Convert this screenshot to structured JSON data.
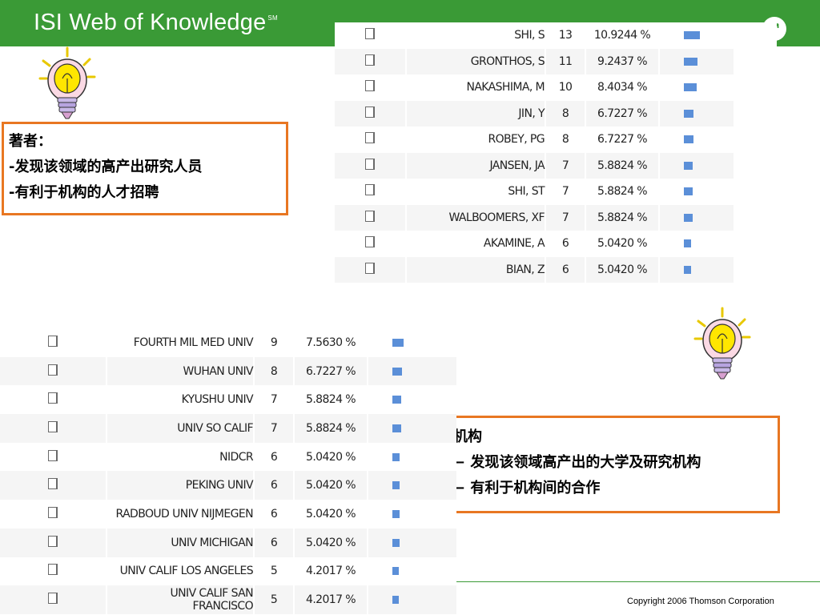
{
  "header": {
    "brand": "ISI Web of Knowledge",
    "brand_mark": "SM",
    "colors": {
      "bar": "#3a9a36",
      "callout_border": "#e87722",
      "bar_fill": "#5b8fd8"
    }
  },
  "authors_callout": {
    "line1": "著者：",
    "line2": "-发现该领域的高产出研究人员",
    "line3": "-有利于机构的人才招聘"
  },
  "orgs_callout": {
    "line1": "机构",
    "line2": "− 发现该领域高产出的大学及研究机构",
    "line3": "− 有利于机构间的合作"
  },
  "author_rows": [
    {
      "name": "SHI, S",
      "count": "13",
      "percent": "10.9244 %",
      "share": 0.109
    },
    {
      "name": "GRONTHOS, S",
      "count": "11",
      "percent": "9.2437 %",
      "share": 0.092
    },
    {
      "name": "NAKASHIMA, M",
      "count": "10",
      "percent": "8.4034 %",
      "share": 0.084
    },
    {
      "name": "JIN, Y",
      "count": "8",
      "percent": "6.7227 %",
      "share": 0.067
    },
    {
      "name": "ROBEY, PG",
      "count": "8",
      "percent": "6.7227 %",
      "share": 0.067
    },
    {
      "name": "JANSEN, JA",
      "count": "7",
      "percent": "5.8824 %",
      "share": 0.059
    },
    {
      "name": "SHI, ST",
      "count": "7",
      "percent": "5.8824 %",
      "share": 0.059
    },
    {
      "name": "WALBOOMERS, XF",
      "count": "7",
      "percent": "5.8824 %",
      "share": 0.059
    },
    {
      "name": "AKAMINE, A",
      "count": "6",
      "percent": "5.0420 %",
      "share": 0.05
    },
    {
      "name": "BIAN, Z",
      "count": "6",
      "percent": "5.0420 %",
      "share": 0.05
    }
  ],
  "org_rows": [
    {
      "name": "FOURTH MIL MED UNIV",
      "count": "9",
      "percent": "7.5630 %",
      "share": 0.076
    },
    {
      "name": "WUHAN UNIV",
      "count": "8",
      "percent": "6.7227 %",
      "share": 0.067
    },
    {
      "name": "KYUSHU UNIV",
      "count": "7",
      "percent": "5.8824 %",
      "share": 0.059
    },
    {
      "name": "UNIV SO CALIF",
      "count": "7",
      "percent": "5.8824 %",
      "share": 0.059
    },
    {
      "name": "NIDCR",
      "count": "6",
      "percent": "5.0420 %",
      "share": 0.05
    },
    {
      "name": "PEKING UNIV",
      "count": "6",
      "percent": "5.0420 %",
      "share": 0.05
    },
    {
      "name": "RADBOUD UNIV NIJMEGEN",
      "count": "6",
      "percent": "5.0420 %",
      "share": 0.05
    },
    {
      "name": "UNIV MICHIGAN",
      "count": "6",
      "percent": "5.0420 %",
      "share": 0.05
    },
    {
      "name": "UNIV CALIF LOS ANGELES",
      "count": "5",
      "percent": "4.2017 %",
      "share": 0.042
    },
    {
      "name": "UNIV CALIF SAN FRANCISCO",
      "count": "5",
      "percent": "4.2017 %",
      "share": 0.042
    }
  ],
  "footer": {
    "copyright": "Copyright 2006 Thomson Corporation"
  }
}
